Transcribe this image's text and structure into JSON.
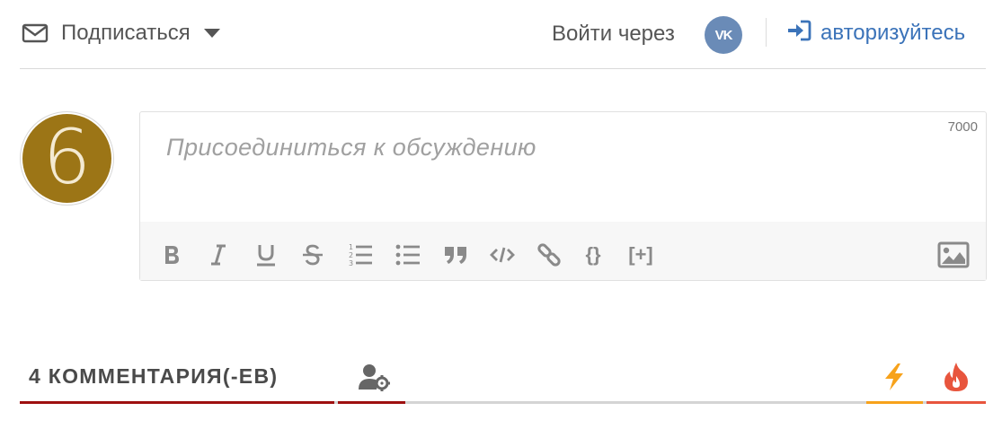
{
  "header": {
    "subscribe_label": "Подписаться",
    "login_through_label": "Войти через",
    "vk_icon_text": "VK",
    "auth_label": "авторизуйтесь"
  },
  "avatar": {
    "letter": "6",
    "color": "#9c7516"
  },
  "editor": {
    "placeholder": "Присоединиться к обсуждению",
    "char_limit": "7000",
    "toolbar": {
      "bold": "bold-icon",
      "italic": "italic-icon",
      "underline": "underline-icon",
      "strikethrough": "strikethrough-icon",
      "ordered_list": "ordered-list-icon",
      "unordered_list": "unordered-list-icon",
      "quote": "quote-icon",
      "code": "code-icon",
      "link": "link-icon",
      "code_block_label": "{}",
      "spoiler_label": "[+]",
      "image": "image-icon"
    }
  },
  "tabs": {
    "comments_count_label": "4 КОММЕНТАРИЯ(-ЕВ)",
    "users_icon": "user-settings-icon",
    "lightning_icon": "lightning-icon",
    "fire_icon": "fire-icon"
  },
  "colors": {
    "accent_red": "#9e0f0f",
    "link_blue": "#3b73b9",
    "vk_blue": "#6a8bb7",
    "lightning_orange": "#f7a21b",
    "fire_red": "#e8553d"
  }
}
